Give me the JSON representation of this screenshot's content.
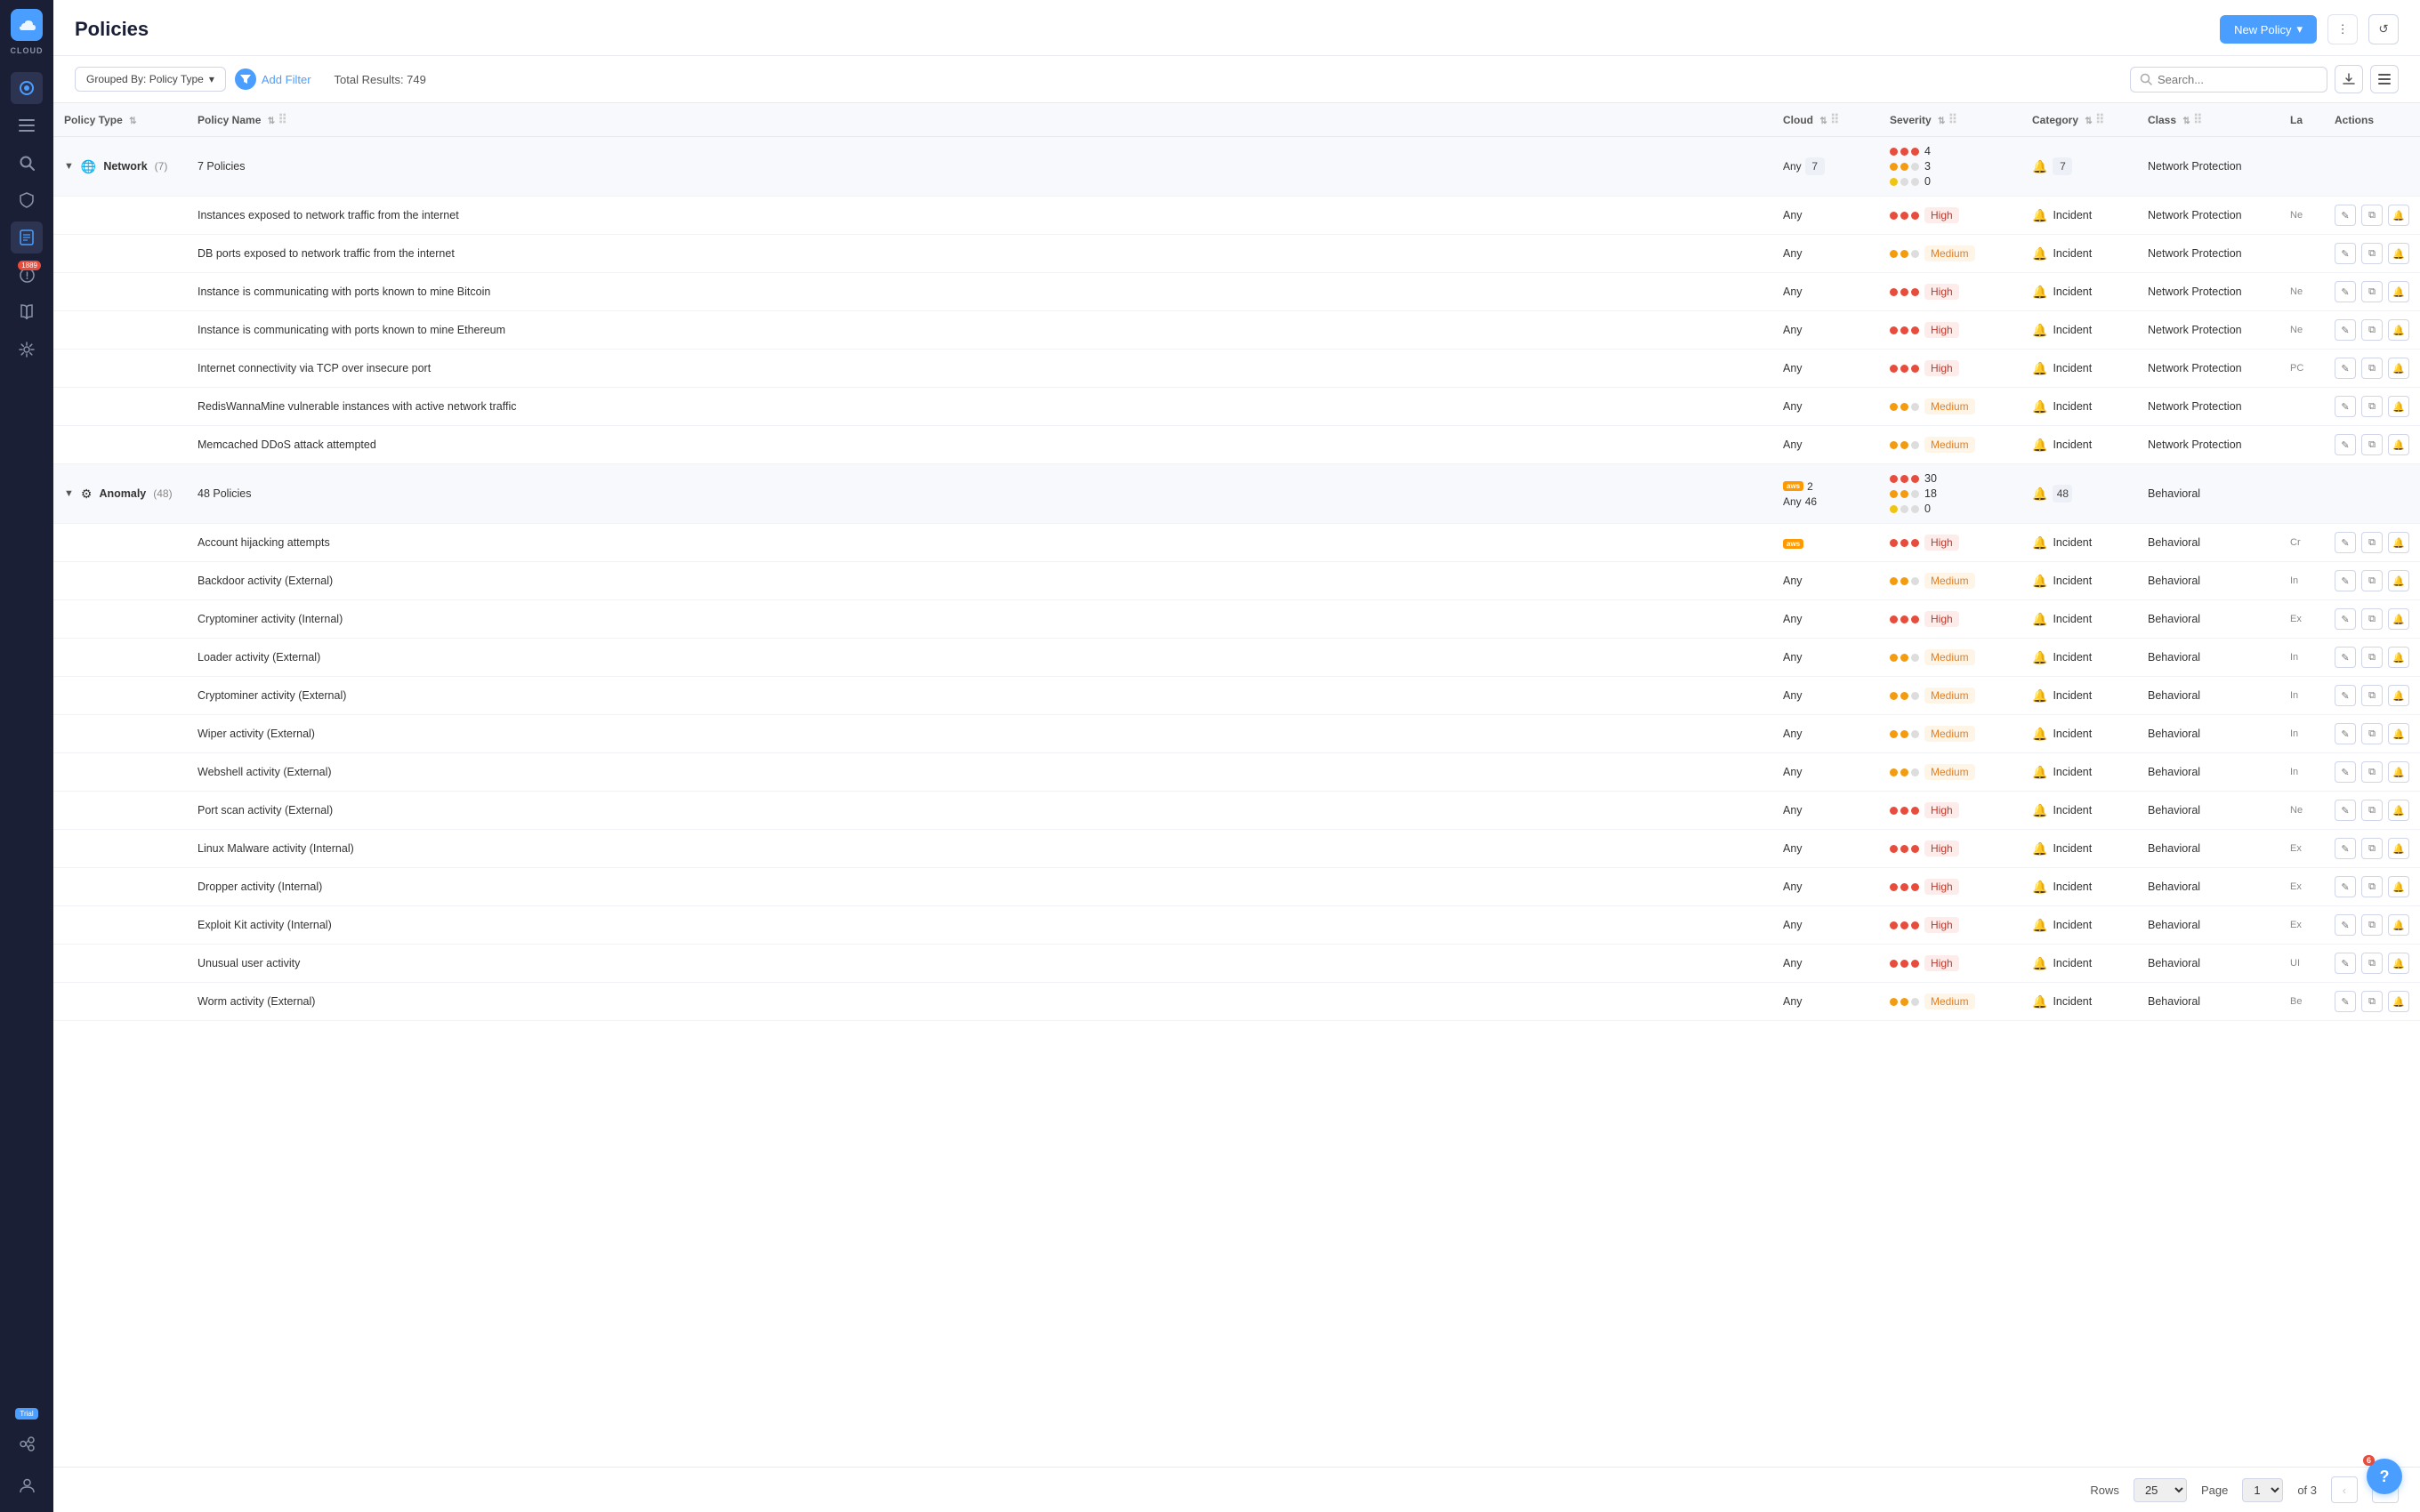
{
  "app": {
    "name": "CLOUD",
    "logo_char": "☁"
  },
  "header": {
    "title": "Policies",
    "new_policy_label": "New Policy",
    "more_icon": "⋮",
    "refresh_icon": "↺"
  },
  "toolbar": {
    "filter_label": "Add Filter",
    "grouped_by_label": "Grouped By: Policy Type",
    "total_results": "Total Results: 749",
    "search_placeholder": "Search...",
    "download_icon": "⬇",
    "list_icon": "☰"
  },
  "table": {
    "columns": [
      {
        "key": "policy_type",
        "label": "Policy Type"
      },
      {
        "key": "policy_name",
        "label": "Policy Name"
      },
      {
        "key": "cloud",
        "label": "Cloud"
      },
      {
        "key": "severity",
        "label": "Severity"
      },
      {
        "key": "category",
        "label": "Category"
      },
      {
        "key": "class",
        "label": "Class"
      },
      {
        "key": "la",
        "label": "La"
      },
      {
        "key": "actions",
        "label": "Actions"
      }
    ],
    "groups": [
      {
        "name": "Network",
        "icon": "🌐",
        "count": 7,
        "expanded": true,
        "summary": {
          "policy_count": "7 Policies",
          "cloud": "Any 7",
          "severity_high": 4,
          "severity_medium": 3,
          "severity_low": 0,
          "category_count": 7,
          "class": "Network Protection"
        },
        "rows": [
          {
            "name": "Instances exposed to network traffic from the internet",
            "cloud": "Any",
            "severity": "High",
            "category": "Incident",
            "class": "Network Protection",
            "la": "Ne"
          },
          {
            "name": "DB ports exposed to network traffic from the internet",
            "cloud": "Any",
            "severity": "Medium",
            "category": "Incident",
            "class": "Network Protection",
            "la": ""
          },
          {
            "name": "Instance is communicating with ports known to mine Bitcoin",
            "cloud": "Any",
            "severity": "High",
            "category": "Incident",
            "class": "Network Protection",
            "la": "Ne"
          },
          {
            "name": "Instance is communicating with ports known to mine Ethereum",
            "cloud": "Any",
            "severity": "High",
            "category": "Incident",
            "class": "Network Protection",
            "la": "Ne"
          },
          {
            "name": "Internet connectivity via TCP over insecure port",
            "cloud": "Any",
            "severity": "High",
            "category": "Incident",
            "class": "Network Protection",
            "la": "PC"
          },
          {
            "name": "RedisWannaMine vulnerable instances with active network traffic",
            "cloud": "Any",
            "severity": "Medium",
            "category": "Incident",
            "class": "Network Protection",
            "la": ""
          },
          {
            "name": "Memcached DDoS attack attempted",
            "cloud": "Any",
            "severity": "Medium",
            "category": "Incident",
            "class": "Network Protection",
            "la": ""
          }
        ]
      },
      {
        "name": "Anomaly",
        "icon": "⚙",
        "count": 48,
        "expanded": true,
        "summary": {
          "policy_count": "48 Policies",
          "cloud_aws": "aws 2",
          "cloud_any": "Any 46",
          "severity_high": 30,
          "severity_medium": 18,
          "severity_low": 0,
          "category_count": 48,
          "class": "Behavioral"
        },
        "rows": [
          {
            "name": "Account hijacking attempts",
            "cloud": "aws",
            "severity": "High",
            "category": "Incident",
            "class": "Behavioral",
            "la": "Cr"
          },
          {
            "name": "Backdoor activity (External)",
            "cloud": "Any",
            "severity": "Medium",
            "category": "Incident",
            "class": "Behavioral",
            "la": "In"
          },
          {
            "name": "Cryptominer activity (Internal)",
            "cloud": "Any",
            "severity": "High",
            "category": "Incident",
            "class": "Behavioral",
            "la": "Ex"
          },
          {
            "name": "Loader activity (External)",
            "cloud": "Any",
            "severity": "Medium",
            "category": "Incident",
            "class": "Behavioral",
            "la": "In"
          },
          {
            "name": "Cryptominer activity (External)",
            "cloud": "Any",
            "severity": "Medium",
            "category": "Incident",
            "class": "Behavioral",
            "la": "In"
          },
          {
            "name": "Wiper activity (External)",
            "cloud": "Any",
            "severity": "Medium",
            "category": "Incident",
            "class": "Behavioral",
            "la": "In"
          },
          {
            "name": "Webshell activity (External)",
            "cloud": "Any",
            "severity": "Medium",
            "category": "Incident",
            "class": "Behavioral",
            "la": "In"
          },
          {
            "name": "Port scan activity (External)",
            "cloud": "Any",
            "severity": "High",
            "category": "Incident",
            "class": "Behavioral",
            "la": "Ne"
          },
          {
            "name": "Linux Malware activity (Internal)",
            "cloud": "Any",
            "severity": "High",
            "category": "Incident",
            "class": "Behavioral",
            "la": "Ex"
          },
          {
            "name": "Dropper activity (Internal)",
            "cloud": "Any",
            "severity": "High",
            "category": "Incident",
            "class": "Behavioral",
            "la": "Ex"
          },
          {
            "name": "Exploit Kit activity (Internal)",
            "cloud": "Any",
            "severity": "High",
            "category": "Incident",
            "class": "Behavioral",
            "la": "Ex"
          },
          {
            "name": "Unusual user activity",
            "cloud": "Any",
            "severity": "High",
            "category": "Incident",
            "class": "Behavioral",
            "la": "UI"
          },
          {
            "name": "Worm activity (External)",
            "cloud": "Any",
            "severity": "Medium",
            "category": "Incident",
            "class": "Behavioral",
            "la": "Be"
          }
        ]
      }
    ]
  },
  "pagination": {
    "rows_label": "Rows",
    "rows_value": "25",
    "page_label": "Page",
    "page_value": "1",
    "of_text": "of 3",
    "prev_label": "‹",
    "next_label": "›"
  },
  "sidebar": {
    "nav_items": [
      {
        "icon": "◉",
        "name": "dashboard"
      },
      {
        "icon": "≡",
        "name": "list"
      },
      {
        "icon": "🔍",
        "name": "search"
      },
      {
        "icon": "🛡",
        "name": "shield"
      },
      {
        "icon": "📋",
        "name": "policies",
        "active": true
      },
      {
        "icon": "⊙",
        "name": "alerts",
        "badge": "1889"
      },
      {
        "icon": "📖",
        "name": "book"
      },
      {
        "icon": "⚙",
        "name": "settings"
      }
    ],
    "bottom_items": [
      {
        "icon": "🔌",
        "name": "integrations"
      },
      {
        "icon": "👤",
        "name": "user"
      }
    ],
    "trial_label": "Trial"
  },
  "help": {
    "badge": "6",
    "icon": "?"
  }
}
